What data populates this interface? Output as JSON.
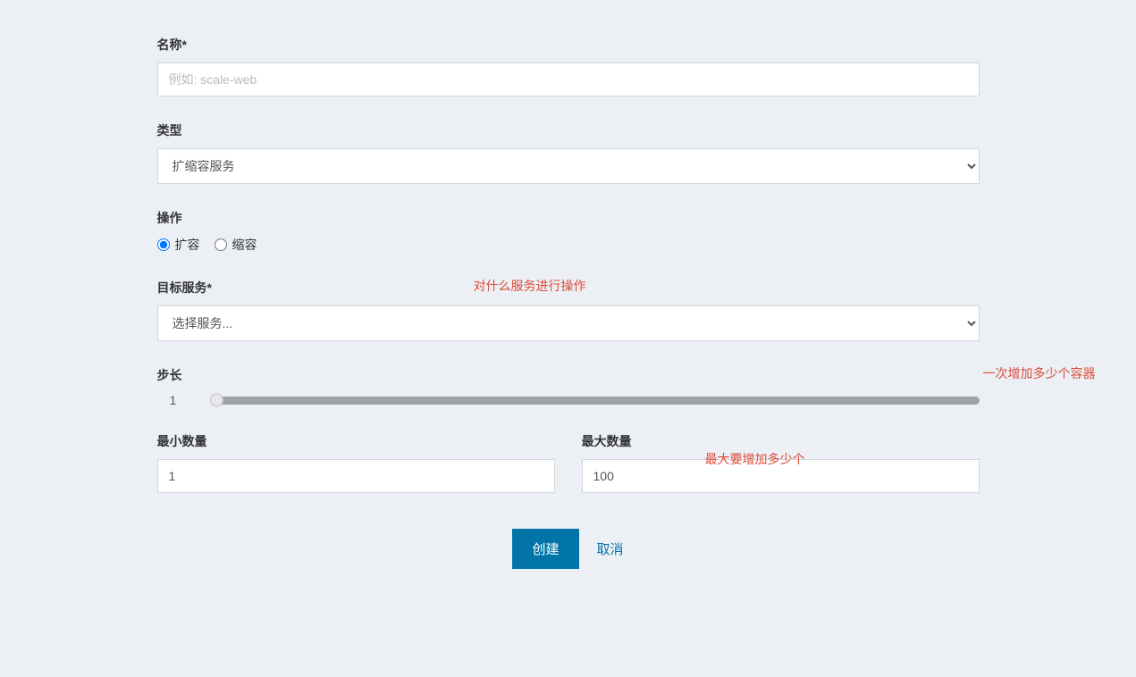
{
  "form": {
    "name_label": "名称*",
    "name_placeholder": "例如: scale-web",
    "type_label": "类型",
    "type_option": "扩缩容服务",
    "action_label": "操作",
    "action_scale_up": "扩容",
    "action_scale_down": "缩容",
    "target_label": "目标服务*",
    "target_option": "选择服务...",
    "step_label": "步长",
    "step_value": "1",
    "min_label": "最小数量",
    "min_value": "1",
    "max_label": "最大数量",
    "max_value": "100",
    "create_button": "创建",
    "cancel_button": "取消"
  },
  "annotations": {
    "target": "对什么服务进行操作",
    "step": "一次增加多少个容器",
    "max": "最大要增加多少个"
  }
}
